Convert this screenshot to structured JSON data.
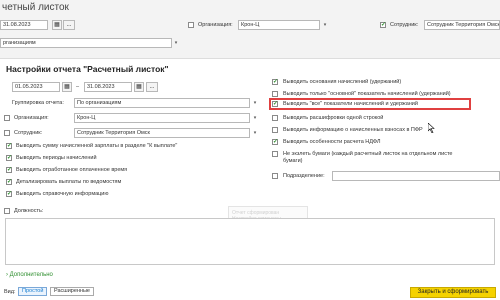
{
  "background": {
    "title": "четный листок",
    "date_field": "31.08.2023",
    "ellipsis_label": "...",
    "org_checkbox_label": "Организация:",
    "org_value": "Крон-Ц",
    "employee_checkbox_label": "Сотрудник:",
    "employee_value": "Сотрудник Территория Омск",
    "grouping_value": "рганизациям"
  },
  "dialog": {
    "heading": "Настройки отчета \"Расчетный листок\"",
    "period_from": "01.05.2023",
    "period_dash": "–",
    "period_to": "31.08.2023",
    "ellipsis_label": "...",
    "grouping_label": "Группировка отчета:",
    "grouping_value": "По организациям",
    "organization_label": "Организация:",
    "organization_value": "Крон-Ц",
    "employee_label": "Сотрудник:",
    "employee_value": "Сотрудник Территория Омск",
    "left_options": [
      {
        "label": "Выводить сумму начисленной зарплаты в разделе \"К выплате\"",
        "checked": true
      },
      {
        "label": "Выводить периоды начислений",
        "checked": true
      },
      {
        "label": "Выводить отработанное оплаченное время",
        "checked": true
      },
      {
        "label": "Детализировать выплаты по ведомостям",
        "checked": true
      },
      {
        "label": "Выводить справочную информацию",
        "checked": true
      }
    ],
    "position_label": "Должность:",
    "right_options": [
      {
        "label": "Выводить основания начислений (удержаний)",
        "checked": true
      },
      {
        "label": "Выводить только \"основной\" показатель начислений (удержаний)",
        "checked": false
      },
      {
        "label": "Выводить \"все\" показатели начислений и удержаний",
        "checked": true
      },
      {
        "label": "Выводить расшифровки одной строкой",
        "checked": false
      },
      {
        "label": "Выводить информацию о начисленных взносах в ПФР",
        "checked": false
      },
      {
        "label": "Выводить особенности расчета НДФЛ",
        "checked": true
      },
      {
        "label": "Не экзлеть бумаги (каждый расчетный листок на отдельном листе бумаги)",
        "checked": false
      }
    ],
    "subdivision_label": "Подразделение:",
    "ghost_text": "Отчет сформирован Настройки изменены",
    "more_link": "Дополнительно",
    "view_label": "Вид:",
    "view_simple": "Простой",
    "view_advanced": "Расширенные",
    "generate_button": "Закрыть и сформировать"
  },
  "colors": {
    "accent_green": "#2f8f2f",
    "primary_button": "#f5d200",
    "highlight_border": "#e04040"
  }
}
